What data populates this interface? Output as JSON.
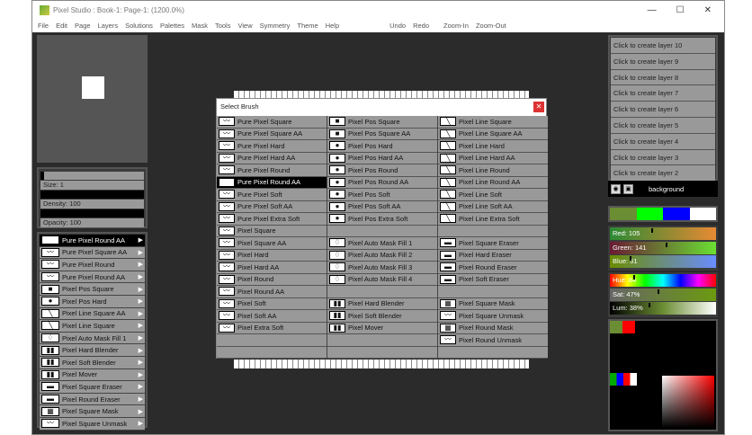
{
  "title": "Pixel Studio : Book-1: Page-1: (1200.0%)",
  "window_controls": [
    "—",
    "☐",
    "✕"
  ],
  "menu": [
    "File",
    "Edit",
    "Page",
    "Layers",
    "Solutions",
    "Palettes",
    "Mask",
    "Tools",
    "View",
    "Symmetry",
    "Theme",
    "Help"
  ],
  "menu_actions": [
    "Undo",
    "Redo",
    "Zoom-In",
    "Zoom-Out"
  ],
  "tool": {
    "size": "Size: 1",
    "density": "Density: 100",
    "opacity": "Opacity: 100"
  },
  "brushes": [
    {
      "label": "Pure Pixel Round AA",
      "sel": true
    },
    {
      "label": "Pure Pixel Square AA"
    },
    {
      "label": "Pure Pixel Round"
    },
    {
      "label": "Pure Pixel Round AA"
    },
    {
      "label": "Pixel Pos Square"
    },
    {
      "label": "Pixel Pos Hard"
    },
    {
      "label": "Pixel Line Square AA"
    },
    {
      "label": "Pixel Line Square"
    },
    {
      "label": "Pixel Auto Mask Fill 1"
    },
    {
      "label": "Pixel Hard Blender"
    },
    {
      "label": "Pixel Soft Blender"
    },
    {
      "label": "Pixel Mover"
    },
    {
      "label": "Pixel Square Eraser"
    },
    {
      "label": "Pixel Round Eraser"
    },
    {
      "label": "Pixel Square Mask"
    },
    {
      "label": "Pixel Square Unmask"
    }
  ],
  "dialog": {
    "title": "Select Brush",
    "close": "✕",
    "columns": [
      [
        "Pure Pixel Square",
        "Pure Pixel Square AA",
        "Pure Pixel Hard",
        "Pure Pixel Hard AA",
        "Pure Pixel Round",
        "Pure Pixel Round AA",
        "Pure Pixel Soft",
        "Pure Pixel Soft AA",
        "Pure Pixel Extra Soft",
        "Pixel Square",
        "Pixel Square AA",
        "Pixel Hard",
        "Pixel Hard AA",
        "Pixel Round",
        "Pixel Round AA",
        "Pixel Soft",
        "Pixel Soft AA",
        "Pixel Extra Soft",
        "",
        ""
      ],
      [
        "Pixel Pos Square",
        "Pixel Pos Square AA",
        "Pixel Pos Hard",
        "Pixel Pos Hard AA",
        "Pixel Pos Round",
        "Pixel Pos Round AA",
        "Pixel Pos Soft",
        "Pixel Pos Soft AA",
        "Pixel Pos Extra Soft",
        "",
        "Pixel Auto Mask Fill 1",
        "Pixel Auto Mask Fill 2",
        "Pixel Auto Mask Fill 3",
        "Pixel Auto Mask Fill 4",
        "",
        "Pixel Hard Blender",
        "Pixel Soft Blender",
        "Pixel Mover",
        "",
        ""
      ],
      [
        "Pixel Line Square",
        "Pixel Line Square AA",
        "Pixel Line Hard",
        "Pixel Line Hard AA",
        "Pixel Line Round",
        "Pixel Line Round AA",
        "Pixel Line Soft",
        "Pixel Line Soft AA",
        "Pixel Line Extra Soft",
        "",
        "Pixel Square Eraser",
        "Pixel Hard Eraser",
        "Pixel Round Eraser",
        "Pixel Soft Eraser",
        "",
        "Pixel Square Mask",
        "Pixel Square Unmask",
        "Pixel Round Mask",
        "Pixel Round Unmask",
        ""
      ]
    ],
    "selected": "Pure Pixel Round AA"
  },
  "layers": [
    "Click to create layer 10",
    "Click to create layer 9",
    "Click to create layer 8",
    "Click to create layer 7",
    "Click to create layer 6",
    "Click to create layer 5",
    "Click to create layer 4",
    "Click to create layer 3",
    "Click to create layer 2"
  ],
  "background_layer": "background",
  "colors": {
    "swatches": [
      "#6b8d33",
      "#00ff00",
      "#0000ff",
      "#ffffff"
    ],
    "red": "Red: 105",
    "green": "Green: 141",
    "blue": "Blue: 51",
    "hue": "Hue: 84",
    "sat": "Sat: 47%",
    "lum": "Lum: 38%",
    "red_v": 105,
    "green_v": 141,
    "blue_v": 51,
    "hue_v": 84,
    "sat_v": 47,
    "lum_v": 38
  }
}
